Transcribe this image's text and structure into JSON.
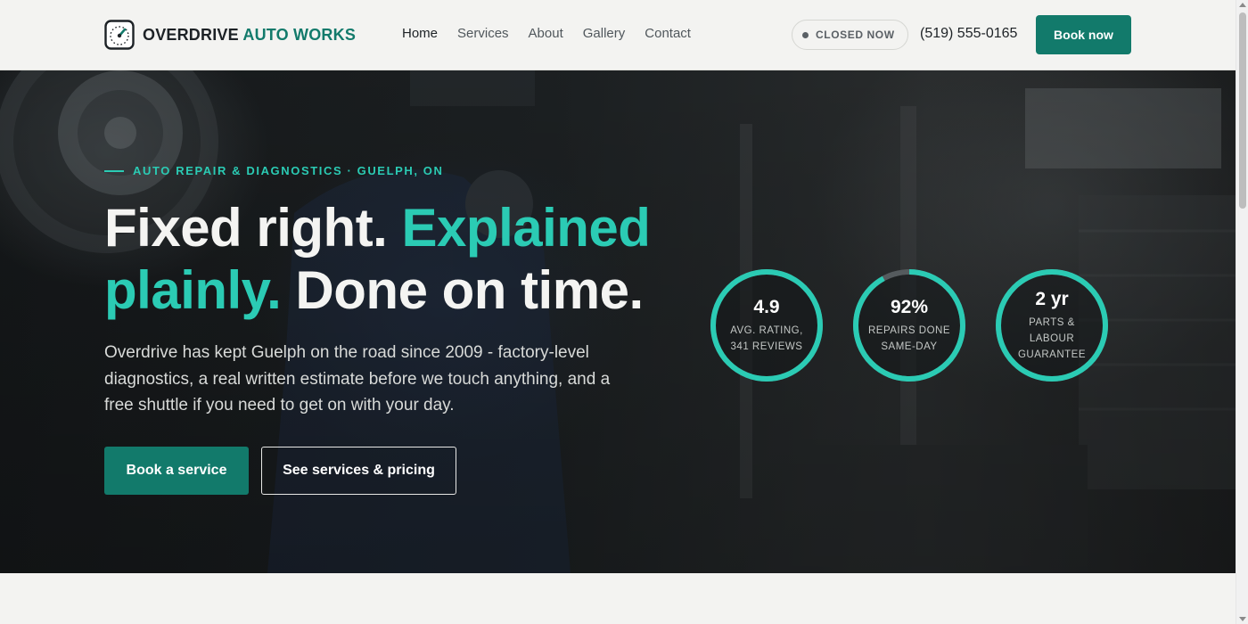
{
  "header": {
    "brand": {
      "name_primary": "OVERDRIVE",
      "name_accent": "AUTO WORKS",
      "logo_icon": "gauge-icon"
    },
    "nav": [
      {
        "label": "Home",
        "active": true
      },
      {
        "label": "Services",
        "active": false
      },
      {
        "label": "About",
        "active": false
      },
      {
        "label": "Gallery",
        "active": false
      },
      {
        "label": "Contact",
        "active": false
      }
    ],
    "status": "CLOSED NOW",
    "phone": "(519) 555-0165",
    "cta": "Book now"
  },
  "hero": {
    "eyebrow": "AUTO REPAIR & DIAGNOSTICS · GUELPH, ON",
    "headline": {
      "part1": "Fixed right. ",
      "part2": "Explained plainly.",
      "part3": " Done on time."
    },
    "lede": "Overdrive has kept Guelph on the road since 2009 - factory-level diagnostics, a real written estimate before we touch anything, and a free shuttle if you need to get on with your day.",
    "primary_cta": "Book a service",
    "secondary_cta": "See services & pricing",
    "stats": [
      {
        "value": "4.9",
        "label": "AVG. RATING, 341 REVIEWS",
        "progress": 1.0
      },
      {
        "value": "92%",
        "label": "REPAIRS DONE SAME-DAY",
        "progress": 0.92
      },
      {
        "value": "2 yr",
        "label": "PARTS & LABOUR GUARANTEE",
        "progress": 1.0
      }
    ]
  },
  "colors": {
    "accent": "#127a6b",
    "accent_light": "#2bcbb4",
    "text_dark": "#1d2226",
    "background": "#f3f3f1"
  }
}
